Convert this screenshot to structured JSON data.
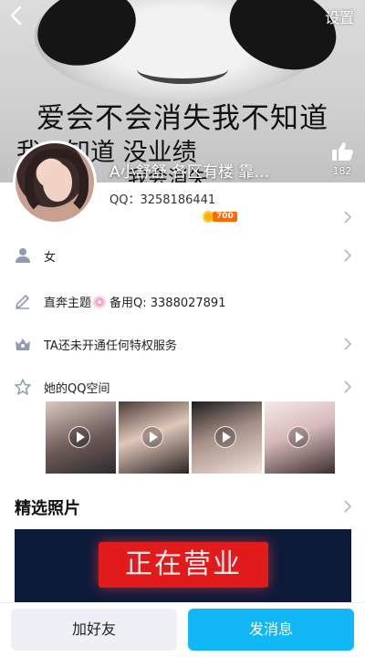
{
  "header": {
    "settings_label": "设置"
  },
  "cover": {
    "meme_line1": "爱会不会消失我不知道",
    "meme_line2": "我只知道 没业绩",
    "meme_line3": "我会消失"
  },
  "profile": {
    "nickname": "A小舒舒 各区有楼 靠…",
    "qq": "QQ：3258186441",
    "level": "700",
    "likes": "182"
  },
  "info_rows": [
    {
      "icon": "person-icon",
      "text": "女"
    },
    {
      "icon": "pencil-icon",
      "text_before": "直奔主题",
      "text_after": "备用Q: 3388027891"
    },
    {
      "icon": "crown-icon",
      "text": "TA还未开通任何特权服务"
    },
    {
      "icon": "star-icon",
      "text": "她的QQ空间"
    }
  ],
  "qzone": {
    "thumbnail_count": 4
  },
  "featured": {
    "title": "精选照片",
    "banner_text": "正在营业"
  },
  "actions": {
    "add_friend": "加好友",
    "send_message": "发消息"
  },
  "colors": {
    "accent": "#12b7f5",
    "badge": "#ff6a00",
    "banner_bg": "#0d1b3a",
    "sign_red": "#e11b1b"
  }
}
